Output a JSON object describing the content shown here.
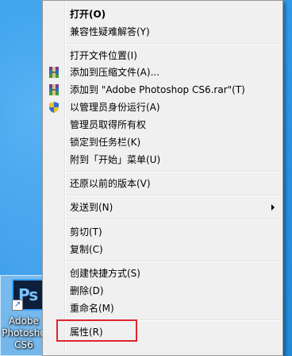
{
  "desktop": {
    "icon_label_lines": [
      "Adobe",
      "Photosho",
      "CS6"
    ],
    "icon_glyph": "Ps",
    "bg_color": "#2a8fe0"
  },
  "menu": {
    "items": [
      {
        "label": "打开(O)",
        "bold": true
      },
      {
        "label": "兼容性疑难解答(Y)"
      },
      {
        "label": "打开文件位置(I)"
      },
      {
        "label": "添加到压缩文件(A)...",
        "icon": "winrar-icon"
      },
      {
        "label": "添加到 \"Adobe Photoshop CS6.rar\"(T)",
        "icon": "winrar-icon"
      },
      {
        "label": "以管理员身份运行(A)",
        "icon": "uac-shield-icon"
      },
      {
        "label": "管理员取得所有权"
      },
      {
        "label": "锁定到任务栏(K)"
      },
      {
        "label": "附到「开始」菜单(U)"
      },
      {
        "label": "还原以前的版本(V)"
      },
      {
        "label": "发送到(N)",
        "submenu": true
      },
      {
        "label": "剪切(T)"
      },
      {
        "label": "复制(C)"
      },
      {
        "label": "创建快捷方式(S)"
      },
      {
        "label": "删除(D)"
      },
      {
        "label": "重命名(M)"
      },
      {
        "label": "属性(R)",
        "highlighted": true
      }
    ]
  },
  "highlight_color": "#e0242b"
}
